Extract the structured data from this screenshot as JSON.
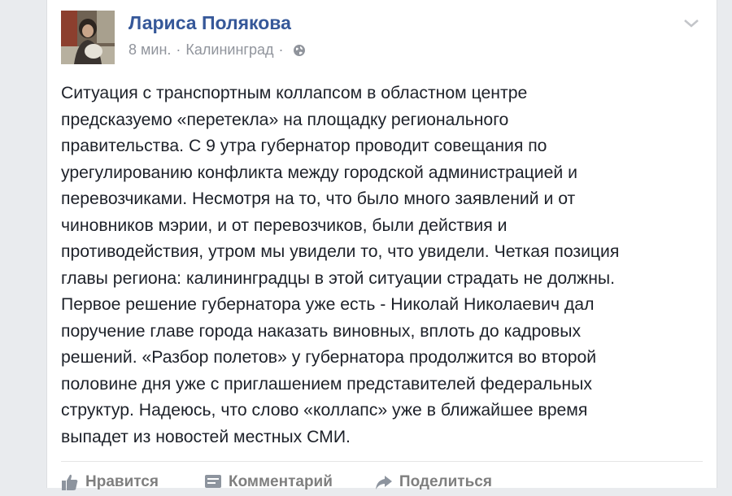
{
  "post": {
    "author": "Лариса Полякова",
    "time": "8 мин.",
    "separator": "·",
    "location": "Калининград",
    "privacy_icon": "globe-icon",
    "lines": [
      "Ситуация с транспортным коллапсом в областном центре",
      "предсказуемо «перетекла» на площадку регионального",
      "правительства. С 9 утра губернатор проводит совещания по",
      "урегулированию конфликта между городской администрацией и",
      "перевозчиками. Несмотря на то, что было много заявлений и от",
      "чиновников мэрии, и от перевозчиков, были действия и",
      "противодействия, утром мы увидели то, что увидели. Четкая позиция",
      "главы региона: калининградцы в этой ситуации страдать не должны.",
      "Первое решение губернатора уже есть - Николай Николаевич дал",
      "поручение главе города наказать виновных, вплоть до кадровых",
      "решений. «Разбор полетов» у губернатора продолжится во второй",
      "половине дня уже с приглашением представителей федеральных",
      "структур. Надеюсь, что слово «коллапс» уже в ближайшее время",
      "выпадет из новостей местных СМИ."
    ]
  },
  "actions": {
    "like_label": "Нравится",
    "comment_label": "Комментарий",
    "share_label": "Поделиться"
  },
  "colors": {
    "author_link": "#365899",
    "meta_text": "#90949c",
    "body_text": "#1d2129",
    "action_text": "#7f7f7f"
  }
}
